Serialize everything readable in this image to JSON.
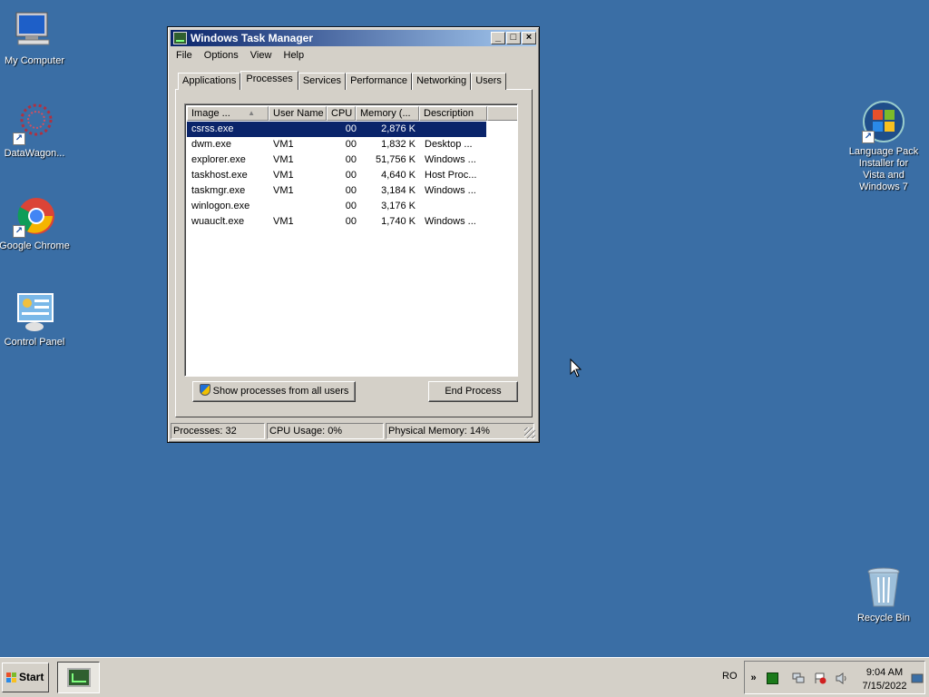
{
  "desktop": {
    "icons": [
      {
        "label": "My Computer"
      },
      {
        "label": "DataWagon..."
      },
      {
        "label": "Google Chrome"
      },
      {
        "label": "Control Panel"
      },
      {
        "label": "Language Pack Installer for Vista and Windows 7"
      },
      {
        "label": "Recycle Bin"
      }
    ]
  },
  "window": {
    "title": "Windows Task Manager",
    "controls": {
      "minimize": "_",
      "maximize": "□",
      "close": "×"
    },
    "menu": [
      "File",
      "Options",
      "View",
      "Help"
    ],
    "tabs": [
      "Applications",
      "Processes",
      "Services",
      "Performance",
      "Networking",
      "Users"
    ],
    "active_tab": "Processes",
    "columns": [
      "Image ...",
      "User Name",
      "CPU",
      "Memory (...",
      "Description"
    ],
    "sort_indicator": "▲",
    "processes": [
      {
        "image": "csrss.exe",
        "user": "",
        "cpu": "00",
        "memory": "2,876 K",
        "description": "",
        "selected": true
      },
      {
        "image": "dwm.exe",
        "user": "VM1",
        "cpu": "00",
        "memory": "1,832 K",
        "description": "Desktop ..."
      },
      {
        "image": "explorer.exe",
        "user": "VM1",
        "cpu": "00",
        "memory": "51,756 K",
        "description": "Windows ..."
      },
      {
        "image": "taskhost.exe",
        "user": "VM1",
        "cpu": "00",
        "memory": "4,640 K",
        "description": "Host Proc..."
      },
      {
        "image": "taskmgr.exe",
        "user": "VM1",
        "cpu": "00",
        "memory": "3,184 K",
        "description": "Windows ..."
      },
      {
        "image": "winlogon.exe",
        "user": "",
        "cpu": "00",
        "memory": "3,176 K",
        "description": ""
      },
      {
        "image": "wuauclt.exe",
        "user": "VM1",
        "cpu": "00",
        "memory": "1,740 K",
        "description": "Windows ..."
      }
    ],
    "buttons": {
      "show_all": "Show processes from all users",
      "end_process": "End Process"
    },
    "status": {
      "processes": "Processes: 32",
      "cpu": "CPU Usage: 0%",
      "memory": "Physical Memory: 14%"
    }
  },
  "taskbar": {
    "start_label": "Start",
    "language": "RO",
    "tray_expand": "»",
    "clock_time": "9:04 AM",
    "clock_date": "7/15/2022"
  }
}
